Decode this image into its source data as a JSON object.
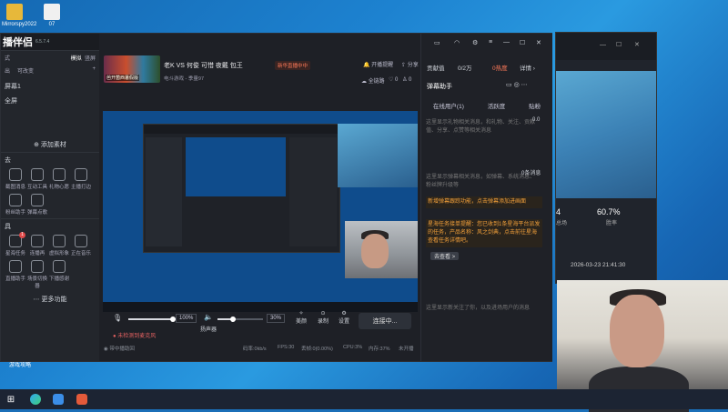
{
  "desktop": {
    "icons": [
      {
        "label": "Mirrorspy2022"
      },
      {
        "label": "07"
      }
    ],
    "bottom_icon_label": "游戏攻略"
  },
  "app": {
    "logo": "播伴侣",
    "version": "6.5.7.4",
    "left": {
      "sec1_label": "式",
      "tab_active": "模拟",
      "tab_other": "竖屏",
      "mode_a": "出",
      "mode_b": "可改变",
      "scene_label": "屏幕1",
      "scene_item": "全屏",
      "add_material": "添加素材",
      "tools_label": "去",
      "tools": [
        "截图消息",
        "互动工具",
        "礼物心愿",
        "主播打边",
        "粉丝助手",
        "弹幕点歌"
      ],
      "apps_label": "具",
      "apps": [
        "星海任务",
        "连播再",
        "虚拟形象",
        "正在音乐",
        "直播助手",
        "场景切换器",
        "下播感谢"
      ],
      "more": "更多功能",
      "badge_count": "1"
    },
    "header": {
      "thumb_text": "芭开菌西暑假版",
      "title": "老K VS 何俊 可惜 夜戴 包王",
      "live_tag": "新华直播中中",
      "category": "电斗游戏 - 季量97",
      "start_label": "开播提醒",
      "share_label": "分享",
      "view_mode": "全链路",
      "likes": "0",
      "fans": "0"
    },
    "controls": {
      "mic_pct": "100%",
      "speaker_label": "扬声器",
      "speaker_pct": "30%",
      "beauty_label": "美颜",
      "record_label": "录制",
      "settings_label": "设置",
      "connect_label": "连接中...",
      "warn": "未检测到麦克风",
      "rate": "码率:0kb/s",
      "fps": "FPS:30",
      "drop": "丢帧:0(0.00%)",
      "cpu": "CPU:3%",
      "mem": "内存:37%",
      "record_status": "未开播",
      "network_hint": "带中播助回"
    },
    "right": {
      "rank_label": "贡献值",
      "rank_value": "0/2万",
      "hot_label": "0热度",
      "detail_label": "详情",
      "panel_title": "弹幕助手",
      "tabs": [
        "在线用户(1)",
        "活跃度",
        "贴粉"
      ],
      "info1": "这里显示礼物相关消息，和礼物、关注、贡献值、分享、点赞等相关消息",
      "online_count": "0.0",
      "info2": "这里显示弹幕相关消息，如弹幕、系统消息、粉丝牌升级等",
      "user_count": "0条消息",
      "orange1": "新增弹幕跟踪功能，点击弹幕添加进画面",
      "orange2": "星海任务接单提醒：您已收到1条星海平台派发的任务，产品名称：风之剑典，点击前往星海查看任务详情吧。",
      "view_btn": "去查看 >",
      "info3": "这里显示新关注了你，以及进场用户的消息"
    }
  },
  "bgwin": {
    "stat_left": "4",
    "stat_right": "60.7%",
    "stat_right_label": "胜率",
    "stat_left_label": "总场",
    "datetime": "2026-03-23 21:41:30"
  },
  "colors": {
    "accent": "#f4a13a",
    "live": "#ff7a59",
    "desktop": "#1b6fb8"
  }
}
